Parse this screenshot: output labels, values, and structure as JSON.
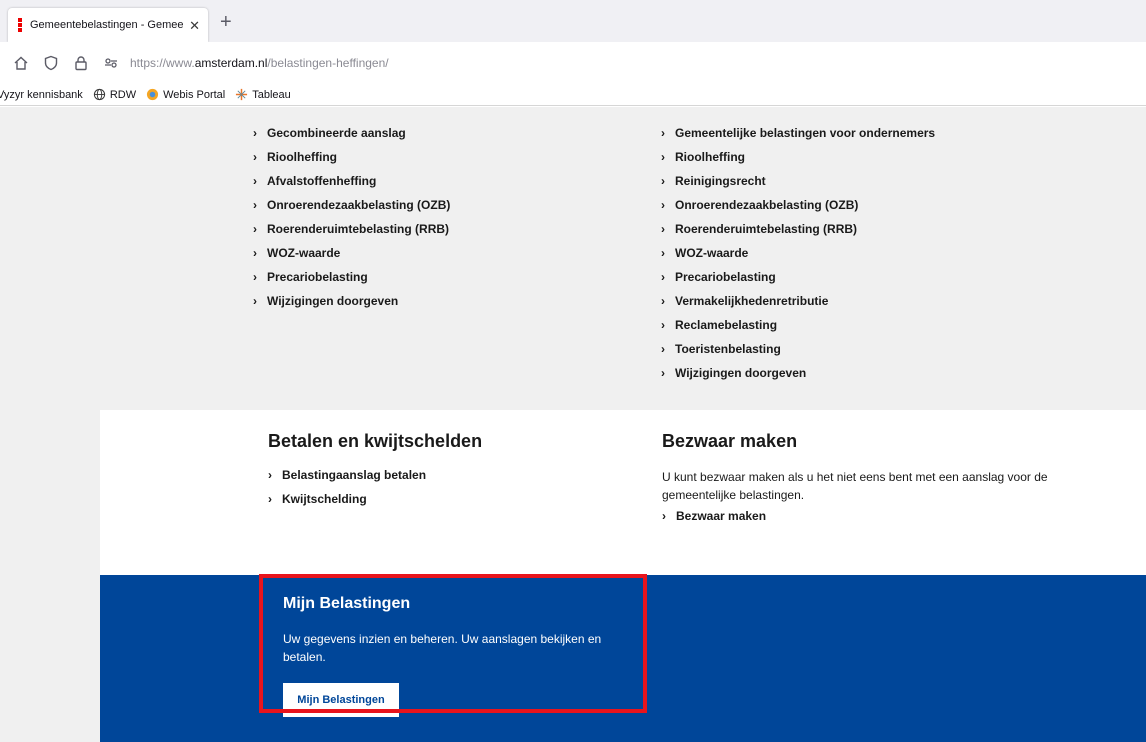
{
  "browser": {
    "tab_title": "Gemeentebelastingen - Gemee",
    "tab_close": "✕",
    "new_tab": "+",
    "url_prefix": "https://www.",
    "url_domain": "amsterdam.nl",
    "url_path": "/belastingen-heffingen/",
    "bookmarks": [
      {
        "label": "Vyzyr kennisbank",
        "icon": "none"
      },
      {
        "label": "RDW",
        "icon": "globe-icon"
      },
      {
        "label": "Webis Portal",
        "icon": "webis-icon"
      },
      {
        "label": "Tableau",
        "icon": "tableau-icon"
      }
    ]
  },
  "lists": {
    "left": [
      "Gecombineerde aanslag",
      "Rioolheffing",
      "Afvalstoffenheffing",
      "Onroerendezaakbelasting (OZB)",
      "Roerenderuimtebelasting (RRB)",
      "WOZ-waarde",
      "Precariobelasting",
      "Wijzigingen doorgeven"
    ],
    "right": [
      "Gemeentelijke belastingen voor ondernemers",
      "Rioolheffing",
      "Reinigingsrecht",
      "Onroerendezaakbelasting (OZB)",
      "Roerenderuimtebelasting (RRB)",
      "WOZ-waarde",
      "Precariobelasting",
      "Vermakelijkhedenretributie",
      "Reclamebelasting",
      "Toeristenbelasting",
      "Wijzigingen doorgeven"
    ]
  },
  "betalen": {
    "title": "Betalen en kwijtschelden",
    "links": [
      "Belastingaanslag betalen",
      "Kwijtschelding"
    ]
  },
  "bezwaar": {
    "title": "Bezwaar maken",
    "text": "U kunt bezwaar maken als u het niet eens bent met een aanslag voor de gemeentelijke belastingen.",
    "link": "Bezwaar maken"
  },
  "mijn": {
    "title": "Mijn Belastingen",
    "text": "Uw gegevens inzien en beheren. Uw aanslagen bekijken en betalen.",
    "button": "Mijn Belastingen"
  },
  "colors": {
    "brand_blue": "#004699",
    "brand_red": "#ec0000",
    "highlight_red": "#e8141c",
    "gray_bg": "#f0f0f0"
  }
}
